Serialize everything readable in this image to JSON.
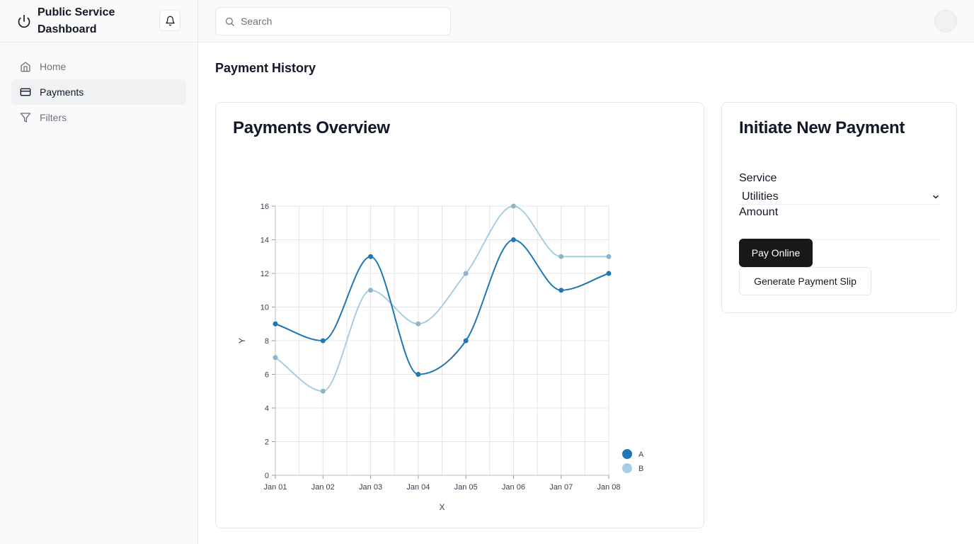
{
  "app": {
    "title": "Public Service Dashboard"
  },
  "sidebar": {
    "items": [
      {
        "label": "Home",
        "icon": "home-icon",
        "active": false
      },
      {
        "label": "Payments",
        "icon": "credit-card-icon",
        "active": true
      },
      {
        "label": "Filters",
        "icon": "filter-icon",
        "active": false
      }
    ]
  },
  "topbar": {
    "search_placeholder": "Search"
  },
  "page": {
    "title": "Payment History"
  },
  "chart_card": {
    "title": "Payments Overview"
  },
  "chart_data": {
    "type": "line",
    "title": "",
    "xlabel": "X",
    "ylabel": "Y",
    "categories": [
      "Jan 01",
      "Jan 02",
      "Jan 03",
      "Jan 04",
      "Jan 05",
      "Jan 06",
      "Jan 07",
      "Jan 08"
    ],
    "ylim": [
      0,
      16
    ],
    "yticks": [
      0,
      2,
      4,
      6,
      8,
      10,
      12,
      14,
      16
    ],
    "grid": true,
    "curve": "smooth",
    "legend_position": "bottom-right",
    "series": [
      {
        "name": "A",
        "color": "#1f77b4",
        "values": [
          9,
          8,
          13,
          6,
          8,
          14,
          11,
          12
        ]
      },
      {
        "name": "B",
        "color": "#a6cee3",
        "values": [
          7,
          5,
          11,
          9,
          12,
          16,
          13,
          13
        ]
      }
    ]
  },
  "payment_form": {
    "title": "Initiate New Payment",
    "service_label": "Service",
    "service_value": "Utilities",
    "amount_label": "Amount",
    "amount_value": "",
    "pay_online_label": "Pay Online",
    "generate_slip_label": "Generate Payment Slip"
  }
}
